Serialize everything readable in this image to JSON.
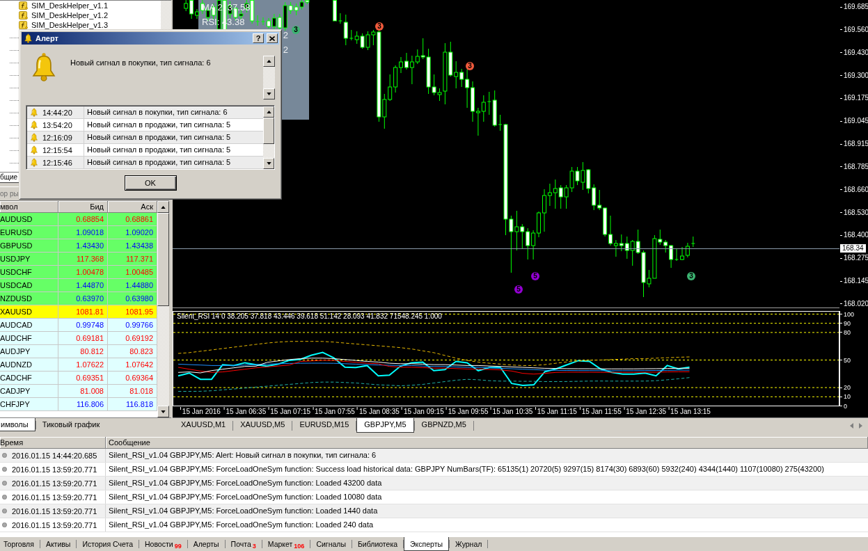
{
  "navigator": {
    "items": [
      {
        "label": "SIM_DeskHelper_v1.1"
      },
      {
        "label": "SIM_DeskHelper_v1.2"
      },
      {
        "label": "SIM_DeskHelper_v1.3"
      }
    ],
    "tabs": [
      {
        "label": "бщие",
        "selected": true
      }
    ]
  },
  "market_watch": {
    "title": "ор ры",
    "columns": [
      "мвол",
      "Бид",
      "Аск"
    ],
    "rows": [
      {
        "symbol": "AUDUSD",
        "bid": "0.68854",
        "ask": "0.68861",
        "falling": true,
        "color": "#66ff66"
      },
      {
        "symbol": "EURUSD",
        "bid": "1.09018",
        "ask": "1.09020",
        "falling": false,
        "color": "#66ff66"
      },
      {
        "symbol": "GBPUSD",
        "bid": "1.43430",
        "ask": "1.43438",
        "falling": false,
        "color": "#66ff66"
      },
      {
        "symbol": "USDJPY",
        "bid": "117.368",
        "ask": "117.371",
        "falling": true,
        "color": "#66ff66"
      },
      {
        "symbol": "USDCHF",
        "bid": "1.00478",
        "ask": "1.00485",
        "falling": true,
        "color": "#66ff66"
      },
      {
        "symbol": "USDCAD",
        "bid": "1.44870",
        "ask": "1.44880",
        "falling": false,
        "color": "#66ff66"
      },
      {
        "symbol": "NZDUSD",
        "bid": "0.63970",
        "ask": "0.63980",
        "falling": false,
        "color": "#66ff66"
      },
      {
        "symbol": "XAUUSD",
        "bid": "1081.81",
        "ask": "1081.95",
        "falling": true,
        "color": "#ffff00"
      },
      {
        "symbol": "AUDCAD",
        "bid": "0.99748",
        "ask": "0.99766",
        "falling": false,
        "color": "#e0ffff"
      },
      {
        "symbol": "AUDCHF",
        "bid": "0.69181",
        "ask": "0.69192",
        "falling": true,
        "color": "#e0ffff"
      },
      {
        "symbol": "AUDJPY",
        "bid": "80.812",
        "ask": "80.823",
        "falling": true,
        "color": "#e0ffff"
      },
      {
        "symbol": "AUDNZD",
        "bid": "1.07622",
        "ask": "1.07642",
        "falling": true,
        "color": "#e0ffff"
      },
      {
        "symbol": "CADCHF",
        "bid": "0.69351",
        "ask": "0.69364",
        "falling": true,
        "color": "#e0ffff"
      },
      {
        "symbol": "CADJPY",
        "bid": "81.008",
        "ask": "81.018",
        "falling": true,
        "color": "#e0ffff"
      },
      {
        "symbol": "CHFJPY",
        "bid": "116.806",
        "ask": "116.818",
        "falling": false,
        "color": "#e0ffff"
      }
    ],
    "tabs": [
      {
        "label": "имволы",
        "selected": true
      },
      {
        "label": "Тиковый график",
        "selected": false
      }
    ]
  },
  "chart": {
    "info_panel": {
      "lines": [
        "MA 2: 37.58",
        "RSI: 43.38"
      ],
      "line_ends": [
        "2",
        "2"
      ]
    },
    "signals": [
      {
        "label": "3",
        "color": "#3cb371"
      },
      {
        "label": "3",
        "color": "#f05a3c"
      },
      {
        "label": "3",
        "color": "#f05a3c"
      },
      {
        "label": "5",
        "color": "#9400d3"
      },
      {
        "label": "5",
        "color": "#9400d3"
      },
      {
        "label": "3",
        "color": "#3cb371"
      }
    ],
    "price_axis": [
      "169.685",
      "169.560",
      "169.430",
      "169.300",
      "169.175",
      "169.045",
      "168.915",
      "168.785",
      "168.660",
      "168.530",
      "168.400",
      "168.275",
      "168.145",
      "168.020"
    ],
    "current_price": "168.34",
    "indicator": {
      "chart_data": {
        "type": "line",
        "title": "Silent_RSI 14 0 38.205 37.818 43.446 39.618 51.142 28.093 41.832 71548.245 1.000",
        "categories": [
          null,
          null,
          "15 Jan 2016",
          null,
          null,
          null,
          "15 Jan 06:35",
          null,
          null,
          null,
          "15 Jan 07:15",
          null,
          null,
          null,
          "15 Jan 07:55",
          null,
          null,
          null,
          "15 Jan 08:35",
          null,
          null,
          null,
          "15 Jan 09:15",
          null,
          null,
          null,
          "15 Jan 09:55",
          null,
          null,
          null,
          "15 Jan 10:35",
          null,
          null,
          null,
          "15 Jan 11:15",
          null,
          null,
          null,
          "15 Jan 11:55",
          null,
          null,
          null,
          "15 Jan 12:35",
          null,
          null,
          null,
          "15 Jan 13:15",
          null,
          null,
          null,
          null,
          null,
          null,
          null,
          null,
          null,
          null,
          null,
          null,
          null
        ],
        "ylim": [
          0,
          103
        ],
        "yticks": [
          0,
          10,
          20,
          50,
          80,
          90,
          100
        ],
        "grid": true,
        "series": [
          {
            "color": "#00ffff",
            "line_style": "solid",
            "values": [
              32.8,
              35.8,
              29.0,
              29.0,
              44.8,
              44.0,
              47.0,
              44.8,
              43.3,
              45.5,
              49.7,
              50.8,
              55.3,
              58.3,
              52.3,
              42.2,
              41.8,
              44.0,
              32.8,
              33.5,
              43.3,
              47.0,
              47.8,
              38.4,
              39.6,
              48.5,
              47.0,
              38.4,
              41.8,
              41.8,
              24.5,
              22.3,
              23.0,
              37.3,
              40.3,
              44.8,
              49.3,
              48.5,
              40.3,
              36.5,
              34.7,
              34.7,
              35.8,
              32.8,
              44.0,
              40.3,
              42.2,
              null,
              null,
              null,
              null,
              null,
              null,
              null,
              null,
              null,
              null,
              null,
              null,
              null
            ]
          },
          {
            "color": "#e6b800",
            "line_style": "dashed",
            "values": [
              57.2,
              58,
              59.5,
              61,
              62.5,
              64,
              65.5,
              67,
              68.5,
              69.5,
              70.2,
              70.3,
              70.3,
              70.2,
              69.5,
              68.5,
              67.5,
              66.5,
              65.5,
              64.5,
              63.5,
              62,
              60,
              58,
              55,
              52,
              49.5,
              47.8,
              46.5,
              45.5,
              44.5,
              44,
              44,
              45,
              46.5,
              48,
              49,
              49.7,
              50,
              50.5,
              51,
              51.5,
              51.5,
              52,
              52.5,
              53,
              53.4,
              null,
              null,
              null,
              null,
              null,
              null,
              null,
              null,
              null,
              null,
              null,
              null,
              null
            ]
          },
          {
            "color": "#20b2aa",
            "line_style": "dashed",
            "values": [
              15.9,
              15.9,
              16,
              16.5,
              17.5,
              18.5,
              19.5,
              20.5,
              21.5,
              22.5,
              23.5,
              24.5,
              25.5,
              26,
              26,
              25.5,
              25,
              24,
              23,
              22.5,
              22,
              22.5,
              23.5,
              25,
              26.5,
              28,
              29,
              28.5,
              27.5,
              27,
              27,
              26.8,
              26.8,
              26.5,
              26.5,
              26.6,
              26.8,
              27,
              27.1,
              27,
              27,
              27,
              27,
              27.5,
              28.5,
              29.5,
              30.9,
              null,
              null,
              null,
              null,
              null,
              null,
              null,
              null,
              null,
              null,
              null,
              null,
              null
            ]
          },
          {
            "color": "#1e90ff",
            "line_style": "solid",
            "values": [
              45.5,
              45,
              44.5,
              44,
              44,
              44,
              44.5,
              45,
              45.5,
              46,
              46.3,
              46.5,
              46.6,
              46.6,
              46.4,
              46,
              45.5,
              45,
              44.5,
              44.3,
              44,
              44,
              43.5,
              43,
              43,
              42.5,
              42,
              42,
              41.5,
              41,
              40.5,
              40,
              39.5,
              39,
              38.8,
              38.6,
              38.5,
              38.5,
              38.4,
              38.4,
              38.4,
              38.4,
              38.5,
              38.6,
              38.8,
              39,
              39,
              null,
              null,
              null,
              null,
              null,
              null,
              null,
              null,
              null,
              null,
              null,
              null,
              null
            ]
          },
          {
            "color": "#ff0000",
            "line_style": "solid",
            "values": [
              42,
              40,
              38,
              36.5,
              37,
              38.5,
              40,
              41.5,
              42.5,
              43.5,
              44.5,
              48.5,
              49,
              49.7,
              49.5,
              48.5,
              47.5,
              46.5,
              45.9,
              43,
              42.2,
              42.2,
              41.7,
              41.2,
              41.2,
              40.7,
              40.2,
              40.2,
              39.7,
              39.2,
              38,
              35.5,
              34.7,
              35.5,
              36.5,
              36.8,
              36.7,
              36.7,
              36.6,
              36.6,
              36.6,
              36.6,
              36.7,
              36.8,
              37,
              37.2,
              37.2,
              null,
              null,
              null,
              null,
              null,
              null,
              null,
              null,
              null,
              null,
              null,
              null,
              null
            ]
          },
          {
            "color": "#ffffff",
            "line_style": "solid",
            "values": [
              36.5,
              37,
              36,
              38.5,
              40,
              41.5,
              43,
              43.3,
              47.5,
              49,
              50.5,
              51.5,
              52,
              52,
              51.5,
              50.5,
              49.5,
              48.5,
              47.8,
              46.5,
              46,
              46,
              45.5,
              45,
              45,
              44.5,
              44,
              44,
              43.5,
              43,
              42.5,
              42,
              41.5,
              41,
              40.8,
              40.6,
              40.5,
              40.5,
              40.4,
              40.4,
              40.4,
              40.4,
              40.5,
              40.6,
              40.8,
              41,
              41,
              null,
              null,
              null,
              null,
              null,
              null,
              null,
              null,
              null,
              null,
              null,
              null,
              null
            ]
          }
        ]
      }
    }
  },
  "chart_tabs": [
    {
      "label": "XAUUSD,M1",
      "selected": false
    },
    {
      "label": "XAUUSD,M5",
      "selected": false
    },
    {
      "label": "EURUSD,M15",
      "selected": false
    },
    {
      "label": "GBPJPY,M5",
      "selected": true
    },
    {
      "label": "GBPNZD,M5",
      "selected": false
    }
  ],
  "terminal": {
    "columns": [
      "Время",
      "Сообщение"
    ],
    "rows": [
      {
        "time": "2016.01.15 14:44:20.685",
        "message": "Silent_RSI_v1.04 GBPJPY,M5: Alert: Новый сигнал в покупки, тип сигнала: 6"
      },
      {
        "time": "2016.01.15 13:59:20.771",
        "message": "Silent_RSI_v1.04 GBPJPY,M5: ForceLoadOneSym function: Success load historical data: GBPJPY NumBars(TF): 65135(1) 20720(5) 9297(15) 8174(30) 6893(60) 5932(240) 4344(1440) 1107(10080) 275(43200)"
      },
      {
        "time": "2016.01.15 13:59:20.771",
        "message": "Silent_RSI_v1.04 GBPJPY,M5: ForceLoadOneSym function: Loaded 43200 data"
      },
      {
        "time": "2016.01.15 13:59:20.771",
        "message": "Silent_RSI_v1.04 GBPJPY,M5: ForceLoadOneSym function: Loaded 10080 data"
      },
      {
        "time": "2016.01.15 13:59:20.771",
        "message": "Silent_RSI_v1.04 GBPJPY,M5: ForceLoadOneSym function: Loaded 1440 data"
      },
      {
        "time": "2016.01.15 13:59:20.771",
        "message": "Silent_RSI_v1.04 GBPJPY,M5: ForceLoadOneSym function: Loaded 240 data"
      }
    ],
    "tabs": [
      {
        "label": "Торговля",
        "selected": false
      },
      {
        "label": "Активы",
        "selected": false
      },
      {
        "label": "История Счета",
        "selected": false
      },
      {
        "label": "Новости",
        "badge": "99",
        "selected": false
      },
      {
        "label": "Алерты",
        "selected": false
      },
      {
        "label": "Почта",
        "badge": "3",
        "selected": false
      },
      {
        "label": "Маркет",
        "badge": "106",
        "selected": false
      },
      {
        "label": "Сигналы",
        "selected": false
      },
      {
        "label": "Библиотека",
        "selected": false
      },
      {
        "label": "Эксперты",
        "selected": true
      },
      {
        "label": "Журнал",
        "selected": false
      }
    ]
  },
  "alert_dialog": {
    "title": "Алерт",
    "help_button": "?",
    "message": "Новый сигнал в покупки, тип сигнала: 6",
    "history": [
      {
        "time": "14:44:20",
        "message": "Новый сигнал в покупки, тип сигнала: 6"
      },
      {
        "time": "13:54:20",
        "message": "Новый сигнал в продажи, тип сигнала: 5"
      },
      {
        "time": "12:16:09",
        "message": "Новый сигнал в продажи, тип сигнала: 5"
      },
      {
        "time": "12:15:54",
        "message": "Новый сигнал в продажи, тип сигнала: 5"
      },
      {
        "time": "12:15:46",
        "message": "Новый сигнал в продажи, тип сигнала: 5"
      }
    ],
    "ok_button": "OK"
  }
}
